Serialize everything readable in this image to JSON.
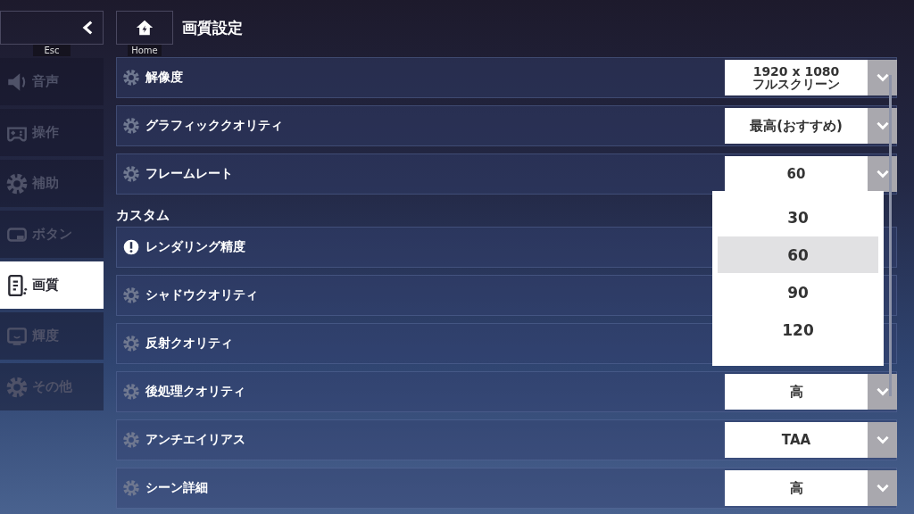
{
  "back": {
    "key": "Esc"
  },
  "home": {
    "key": "Home"
  },
  "title": "画質設定",
  "sidebar": {
    "items": [
      {
        "kind": "sound",
        "label": "音声",
        "selected": false
      },
      {
        "kind": "controls",
        "label": "操作",
        "selected": false
      },
      {
        "kind": "assist",
        "label": "補助",
        "selected": false
      },
      {
        "kind": "buttons",
        "label": "ボタン",
        "selected": false
      },
      {
        "kind": "graphics",
        "label": "画質",
        "selected": true
      },
      {
        "kind": "brightness",
        "label": "輝度",
        "selected": false
      },
      {
        "kind": "other",
        "label": "その他",
        "selected": false
      }
    ]
  },
  "sections": [
    {
      "rows": [
        {
          "kind": "gear",
          "label": "解像度",
          "value": [
            "1920 x 1080",
            "フルスクリーン"
          ]
        },
        {
          "kind": "gear",
          "label": "グラフィッククオリティ",
          "value": [
            "最高(おすすめ)"
          ]
        },
        {
          "kind": "gear",
          "label": "フレームレート",
          "value": [
            "60"
          ]
        }
      ]
    },
    {
      "heading": "カスタム",
      "rows": [
        {
          "kind": "warning",
          "label": "レンダリング精度"
        },
        {
          "kind": "gear",
          "label": "シャドウクオリティ"
        },
        {
          "kind": "gear",
          "label": "反射クオリティ"
        },
        {
          "kind": "gear",
          "label": "後処理クオリティ",
          "value": [
            "高"
          ]
        },
        {
          "kind": "gear",
          "label": "アンチエイリアス",
          "value": [
            "TAA"
          ]
        },
        {
          "kind": "gear",
          "label": "シーン詳細",
          "value": [
            "高"
          ]
        }
      ]
    }
  ],
  "dropdown": {
    "options": [
      {
        "label": "30",
        "selected": false
      },
      {
        "label": "60",
        "selected": true
      },
      {
        "label": "90",
        "selected": false
      },
      {
        "label": "120",
        "selected": false
      }
    ]
  }
}
